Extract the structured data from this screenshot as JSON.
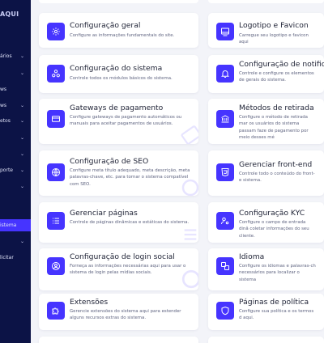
{
  "sidebar": {
    "logo": "AQUI",
    "items": [
      {
        "label": "ários",
        "chevron": true
      },
      {
        "label": "",
        "chevron": true
      },
      {
        "label": "ws",
        "chevron": false
      },
      {
        "label": "ws",
        "chevron": true
      },
      {
        "label": "etos",
        "chevron": true
      },
      {
        "label": "",
        "chevron": true
      },
      {
        "label": "",
        "chevron": true
      },
      {
        "label": "porte",
        "chevron": true
      },
      {
        "label": "",
        "chevron": true
      },
      {
        "label": "istema",
        "chevron": false,
        "active": true
      },
      {
        "label": "",
        "chevron": true
      },
      {
        "label": "licitar",
        "chevron": false
      }
    ],
    "chevron_glyph": "⌄"
  },
  "cards": [
    {
      "title": "Configuração geral",
      "description": "Configure as informações fundamentais do site.",
      "icon": "gear-icon"
    },
    {
      "title": "Logotipo e Favicon",
      "description": "Carregue seu logotipo e favicon aqui",
      "icon": "image-icon"
    },
    {
      "title": "Configuração do sistema",
      "description": "Controle todos os módulos básicos do sistema.",
      "icon": "modules-icon"
    },
    {
      "title": "Configuração de notific",
      "description": "Controle e configure os elementos de gerais do sistema.",
      "icon": "bell-icon"
    },
    {
      "title": "Gateways de pagamento",
      "description": "Configure gateways de pagamento automáticos ou manuais para aceitar pagamentos de usuários.",
      "icon": "credit-card-icon"
    },
    {
      "title": "Métodos de retirada",
      "description": "Configure o método de retirada mar os usuários do sistema passam faze de pagamento por meio desses mé",
      "icon": "bank-icon"
    },
    {
      "title": "Configuração de SEO",
      "description": "Configure meta título adequado, meta descrição, meta palavras-chave, etc. para tornar o sistema compatível com SEO.",
      "icon": "globe-icon"
    },
    {
      "title": "Gerenciar front-end",
      "description": "Controle todo o conteúdo do front-e sistema.",
      "icon": "html5-icon"
    },
    {
      "title": "Gerenciar páginas",
      "description": "Controle de páginas dinâmicas e estáticas do sistema.",
      "icon": "list-icon"
    },
    {
      "title": "Configuração KYC",
      "description": "Configure o campo de entrada dinâ coletar informações do seu cliente.",
      "icon": "user-gear-icon"
    },
    {
      "title": "Configuração de login social",
      "description": "Forneça as informações necessárias aqui para usar o sistema de login pelas mídias sociais.",
      "icon": "user-circle-icon"
    },
    {
      "title": "Idioma",
      "description": "Configure os idiomas e palavras-ch necessários para localizar o sistema",
      "icon": "language-icon"
    },
    {
      "title": "Extensões",
      "description": "Gerencie extensões do sistema aqui para estender alguns recursos extras do sistema.",
      "icon": "puzzle-icon"
    },
    {
      "title": "Páginas de política",
      "description": "Configure sua política e os termos d aqui.",
      "icon": "shield-icon"
    }
  ],
  "colors": {
    "sidebar_bg": "#0c1346",
    "accent": "#4634ff",
    "page_bg": "#f3f4f9",
    "card_bg": "#ffffff",
    "title_text": "#1e2235",
    "desc_text": "#5f6480"
  }
}
